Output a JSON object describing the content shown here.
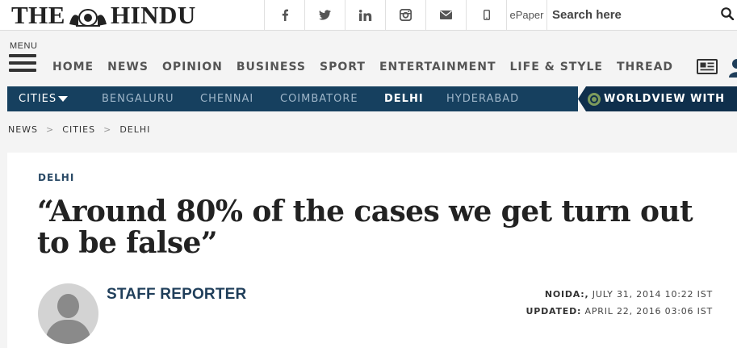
{
  "header": {
    "logo_left": "THE",
    "logo_right": "HINDU",
    "social": [
      {
        "icon": "facebook-icon"
      },
      {
        "icon": "twitter-icon"
      },
      {
        "icon": "linkedin-icon"
      },
      {
        "icon": "instagram-icon"
      },
      {
        "icon": "mail-icon"
      },
      {
        "icon": "mobile-icon"
      }
    ],
    "epaper_label": "ePaper",
    "search_placeholder": "Search here"
  },
  "menu": {
    "menu_label": "MENU",
    "items": [
      "HOME",
      "NEWS",
      "OPINION",
      "BUSINESS",
      "SPORT",
      "ENTERTAINMENT",
      "LIFE & STYLE",
      "THREAD"
    ]
  },
  "citybar": {
    "toggle_label": "CITIES",
    "cities": [
      "BENGALURU",
      "CHENNAI",
      "COIMBATORE",
      "DELHI",
      "HYDERABAD"
    ],
    "active_city": "DELHI",
    "worldview_label": "WORLDVIEW WITH",
    "bar_color": "#16405f"
  },
  "breadcrumb": {
    "items": [
      "NEWS",
      "CITIES",
      "DELHI"
    ],
    "separator": ">"
  },
  "article": {
    "kicker": "DELHI",
    "headline": "“Around 80% of the cases we get turn out to be false”",
    "author": "STAFF REPORTER",
    "dateline_label": "NOIDA:,",
    "dateline_value": "JULY 31, 2014 10:22 IST",
    "updated_label": "UPDATED:",
    "updated_value": "APRIL 22, 2016 03:06 IST"
  }
}
